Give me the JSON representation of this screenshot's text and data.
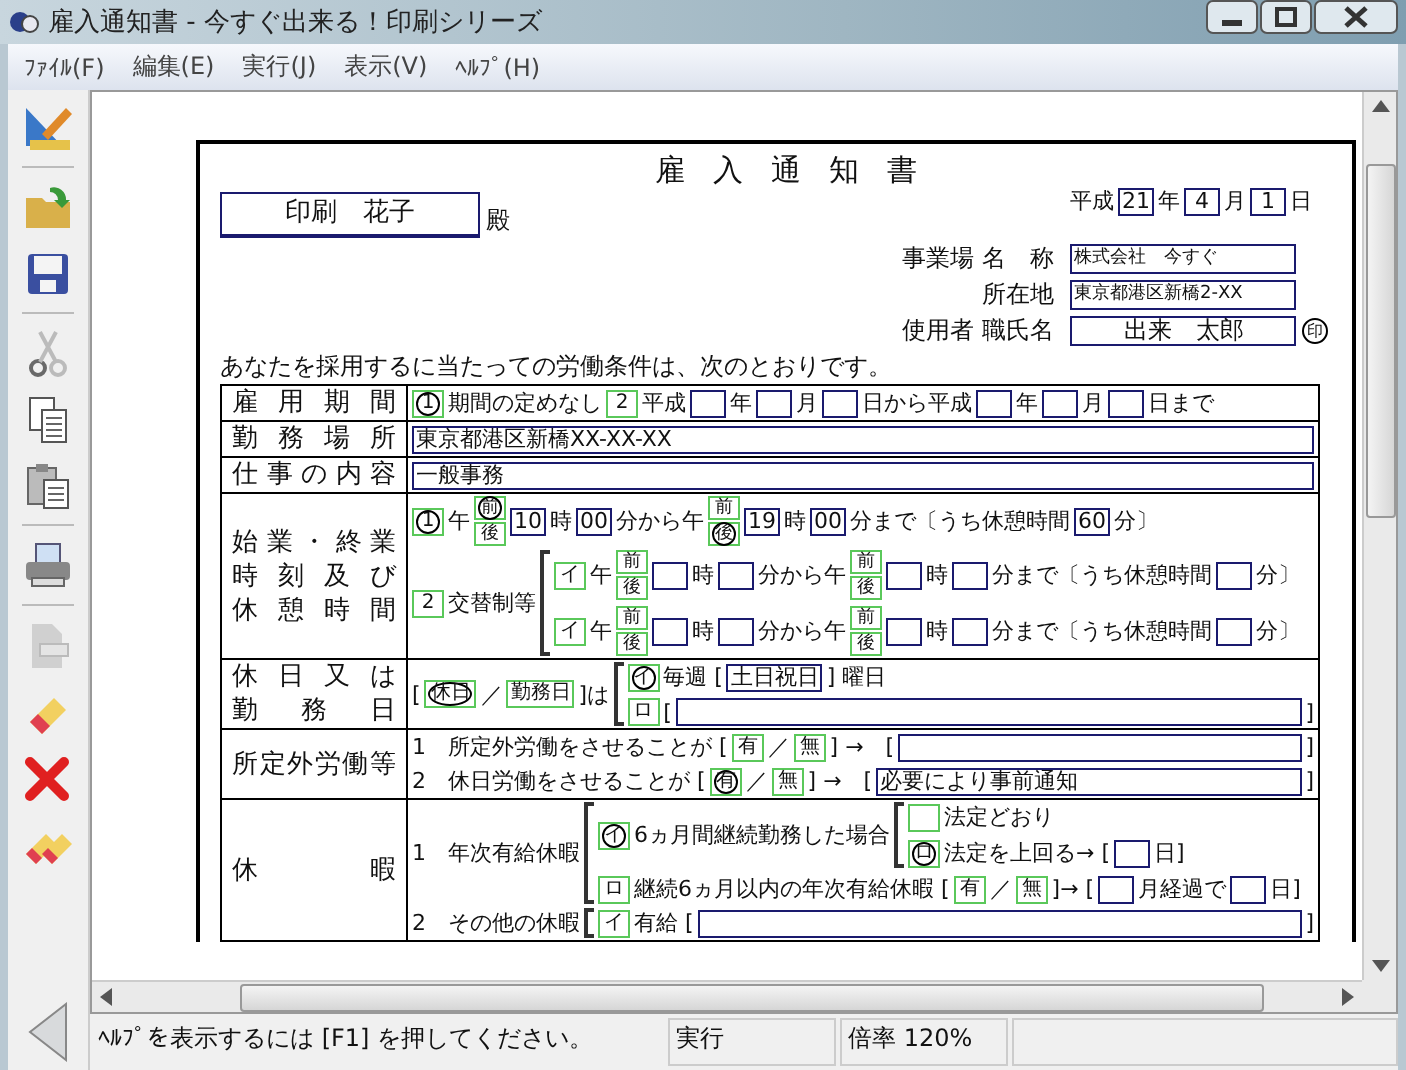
{
  "window": {
    "title": "雇入通知書 - 今すぐ出来る！印刷シリーズ"
  },
  "menu": [
    "ﾌｧｲﾙ(F)",
    "編集(E)",
    "実行(J)",
    "表示(V)",
    "ﾍﾙﾌﾟ(H)"
  ],
  "toolbar": [
    {
      "kind": "design",
      "separator_after": true,
      "disabled": false
    },
    {
      "kind": "open",
      "separator_after": false,
      "disabled": false
    },
    {
      "kind": "save",
      "separator_after": true,
      "disabled": false
    },
    {
      "kind": "cut",
      "separator_after": false,
      "disabled": true
    },
    {
      "kind": "copy",
      "separator_after": false,
      "disabled": false
    },
    {
      "kind": "paste",
      "separator_after": true,
      "disabled": false
    },
    {
      "kind": "print",
      "separator_after": true,
      "disabled": false
    },
    {
      "kind": "preview",
      "separator_after": false,
      "disabled": true
    },
    {
      "kind": "eraser",
      "separator_after": false,
      "disabled": false
    },
    {
      "kind": "delete",
      "separator_after": false,
      "disabled": false
    },
    {
      "kind": "clear",
      "separator_after": false,
      "disabled": false
    }
  ],
  "form": {
    "title": "雇入通知書",
    "date": [
      {
        "kind": "text",
        "text": "平成"
      },
      {
        "kind": "box",
        "value": "21"
      },
      {
        "kind": "text",
        "text": "年"
      },
      {
        "kind": "box",
        "value": "4"
      },
      {
        "kind": "text",
        "text": "月"
      },
      {
        "kind": "box",
        "value": "1"
      },
      {
        "kind": "text",
        "text": "日"
      }
    ],
    "recipient": {
      "name": "印刷　花子",
      "suffix": "殿"
    },
    "employer": [
      {
        "group": "事業場",
        "label": "名　称",
        "value": "株式会社　今すぐ"
      },
      {
        "label": "所在地",
        "value": "東京都港区新橋2-XX"
      },
      {
        "group": "使用者",
        "label": "職氏名",
        "value": "出来　太郎",
        "seal": "印"
      }
    ],
    "intro": "あなたを採用するに当たっての労働条件は、次のとおりです。",
    "rows": [
      {
        "label": [
          "雇用期間"
        ],
        "lines": [
          [
            {
              "kind": "opt",
              "label": "1",
              "selected": true
            },
            {
              "kind": "text",
              "text": "期間の定めなし"
            },
            {
              "kind": "opt",
              "label": "2",
              "selected": false
            },
            {
              "kind": "text",
              "text": "平成"
            },
            {
              "kind": "box"
            },
            {
              "kind": "text",
              "text": "年"
            },
            {
              "kind": "box"
            },
            {
              "kind": "text",
              "text": "月"
            },
            {
              "kind": "box"
            },
            {
              "kind": "text",
              "text": "日から平成"
            },
            {
              "kind": "box"
            },
            {
              "kind": "text",
              "text": "年"
            },
            {
              "kind": "box"
            },
            {
              "kind": "text",
              "text": "月"
            },
            {
              "kind": "box"
            },
            {
              "kind": "text",
              "text": "日まで"
            }
          ]
        ]
      },
      {
        "label": [
          "勤務場所"
        ],
        "lines": [
          [
            {
              "kind": "box",
              "value": "東京都港区新橋XX-XX-XX",
              "wide": true
            }
          ]
        ]
      },
      {
        "label": [
          "仕事の内容"
        ],
        "lines": [
          [
            {
              "kind": "box",
              "value": "一般事務",
              "wide": true
            }
          ]
        ]
      },
      {
        "label": [
          "始業・終業",
          "時刻及び",
          "休憩時間"
        ],
        "lines": [
          [
            {
              "kind": "opt",
              "label": "1",
              "selected": true
            },
            {
              "kind": "text",
              "text": "午"
            },
            {
              "kind": "ampm",
              "options": [
                {
                  "label": "前",
                  "selected": true
                },
                {
                  "label": "後",
                  "selected": false
                }
              ]
            },
            {
              "kind": "box",
              "value": "10"
            },
            {
              "kind": "text",
              "text": "時"
            },
            {
              "kind": "box",
              "value": "00"
            },
            {
              "kind": "text",
              "text": "分から午"
            },
            {
              "kind": "ampm",
              "options": [
                {
                  "label": "前",
                  "selected": false
                },
                {
                  "label": "後",
                  "selected": true
                }
              ]
            },
            {
              "kind": "box",
              "value": "19"
            },
            {
              "kind": "text",
              "text": "時"
            },
            {
              "kind": "box",
              "value": "00"
            },
            {
              "kind": "text",
              "text": "分まで〔うち休憩時間"
            },
            {
              "kind": "box",
              "value": "60"
            },
            {
              "kind": "text",
              "text": "分〕"
            }
          ],
          [
            {
              "kind": "opt",
              "label": "2",
              "selected": false
            },
            {
              "kind": "text",
              "text": "交替制等"
            },
            {
              "kind": "stack",
              "lines": [
                [
                  {
                    "kind": "opt",
                    "label": "イ",
                    "selected": false
                  },
                  {
                    "kind": "text",
                    "text": "午"
                  },
                  {
                    "kind": "ampm",
                    "options": [
                      {
                        "label": "前",
                        "selected": false
                      },
                      {
                        "label": "後",
                        "selected": false
                      }
                    ]
                  },
                  {
                    "kind": "box"
                  },
                  {
                    "kind": "text",
                    "text": "時"
                  },
                  {
                    "kind": "box"
                  },
                  {
                    "kind": "text",
                    "text": "分から午"
                  },
                  {
                    "kind": "ampm",
                    "options": [
                      {
                        "label": "前",
                        "selected": false
                      },
                      {
                        "label": "後",
                        "selected": false
                      }
                    ]
                  },
                  {
                    "kind": "box"
                  },
                  {
                    "kind": "text",
                    "text": "時"
                  },
                  {
                    "kind": "box"
                  },
                  {
                    "kind": "text",
                    "text": "分まで〔うち休憩時間"
                  },
                  {
                    "kind": "box"
                  },
                  {
                    "kind": "text",
                    "text": "分〕"
                  }
                ],
                [
                  {
                    "kind": "opt",
                    "label": "イ",
                    "selected": false
                  },
                  {
                    "kind": "text",
                    "text": "午"
                  },
                  {
                    "kind": "ampm",
                    "options": [
                      {
                        "label": "前",
                        "selected": false
                      },
                      {
                        "label": "後",
                        "selected": false
                      }
                    ]
                  },
                  {
                    "kind": "box"
                  },
                  {
                    "kind": "text",
                    "text": "時"
                  },
                  {
                    "kind": "box"
                  },
                  {
                    "kind": "text",
                    "text": "分から午"
                  },
                  {
                    "kind": "ampm",
                    "options": [
                      {
                        "label": "前",
                        "selected": false
                      },
                      {
                        "label": "後",
                        "selected": false
                      }
                    ]
                  },
                  {
                    "kind": "box"
                  },
                  {
                    "kind": "text",
                    "text": "時"
                  },
                  {
                    "kind": "box"
                  },
                  {
                    "kind": "text",
                    "text": "分まで〔うち休憩時間"
                  },
                  {
                    "kind": "box"
                  },
                  {
                    "kind": "text",
                    "text": "分〕"
                  }
                ]
              ]
            }
          ]
        ]
      },
      {
        "label": [
          "休日又は",
          "勤務日"
        ],
        "lines": [
          [
            {
              "kind": "text",
              "text": "["
            },
            {
              "kind": "opt",
              "label": "休日",
              "selected": true
            },
            {
              "kind": "text",
              "text": "／"
            },
            {
              "kind": "opt",
              "label": "勤務日",
              "selected": false
            },
            {
              "kind": "text",
              "text": "]は"
            },
            {
              "kind": "stack",
              "lines": [
                [
                  {
                    "kind": "opt",
                    "label": "イ",
                    "selected": true
                  },
                  {
                    "kind": "text",
                    "text": "毎週 ["
                  },
                  {
                    "kind": "box",
                    "value": "土日祝日"
                  },
                  {
                    "kind": "text",
                    "text": "] 曜日"
                  }
                ],
                [
                  {
                    "kind": "opt",
                    "label": "ロ",
                    "selected": false
                  },
                  {
                    "kind": "text",
                    "text": "["
                  },
                  {
                    "kind": "box",
                    "wide": true
                  },
                  {
                    "kind": "text",
                    "text": "]"
                  }
                ]
              ]
            }
          ]
        ]
      },
      {
        "label": [
          "所定外労働等"
        ],
        "lines": [
          [
            {
              "kind": "text",
              "text": "1　所定外労働をさせることが ["
            },
            {
              "kind": "opt",
              "label": "有",
              "selected": false
            },
            {
              "kind": "text",
              "text": "／"
            },
            {
              "kind": "opt",
              "label": "無",
              "selected": false
            },
            {
              "kind": "text",
              "text": "] →　["
            },
            {
              "kind": "box",
              "wide": true
            },
            {
              "kind": "text",
              "text": "]"
            }
          ],
          [
            {
              "kind": "text",
              "text": "2　休日労働をさせることが ["
            },
            {
              "kind": "opt",
              "label": "有",
              "selected": true
            },
            {
              "kind": "text",
              "text": "／"
            },
            {
              "kind": "opt",
              "label": "無",
              "selected": false
            },
            {
              "kind": "text",
              "text": "] →　["
            },
            {
              "kind": "box",
              "value": "必要により事前通知",
              "wide": true
            },
            {
              "kind": "text",
              "text": "]"
            }
          ]
        ]
      },
      {
        "label": [
          "休暇"
        ],
        "lines": [
          [
            {
              "kind": "text",
              "text": "1　年次有給休暇"
            },
            {
              "kind": "stack",
              "lines": [
                [
                  {
                    "kind": "opt",
                    "label": "イ",
                    "selected": true
                  },
                  {
                    "kind": "text",
                    "text": "6ヵ月間継続勤務した場合"
                  },
                  {
                    "kind": "stack",
                    "lines": [
                      [
                        {
                          "kind": "opt",
                          "selected": false
                        },
                        {
                          "kind": "text",
                          "text": "法定どおり"
                        }
                      ],
                      [
                        {
                          "kind": "opt",
                          "label": "ロ",
                          "selected": true
                        },
                        {
                          "kind": "text",
                          "text": "法定を上回る→ ["
                        },
                        {
                          "kind": "box"
                        },
                        {
                          "kind": "text",
                          "text": "日]"
                        }
                      ]
                    ]
                  }
                ],
                [
                  {
                    "kind": "opt",
                    "label": "ロ",
                    "selected": false
                  },
                  {
                    "kind": "text",
                    "text": "継続6ヵ月以内の年次有給休暇 ["
                  },
                  {
                    "kind": "opt",
                    "label": "有",
                    "selected": false
                  },
                  {
                    "kind": "text",
                    "text": "／"
                  },
                  {
                    "kind": "opt",
                    "label": "無",
                    "selected": false
                  },
                  {
                    "kind": "text",
                    "text": "]→ ["
                  },
                  {
                    "kind": "box"
                  },
                  {
                    "kind": "text",
                    "text": "月経過で"
                  },
                  {
                    "kind": "box"
                  },
                  {
                    "kind": "text",
                    "text": "日]"
                  }
                ]
              ]
            }
          ],
          [
            {
              "kind": "text",
              "text": "2　その他の休暇"
            },
            {
              "kind": "stack",
              "lines": [
                [
                  {
                    "kind": "opt",
                    "label": "イ",
                    "selected": false
                  },
                  {
                    "kind": "text",
                    "text": "有給 ["
                  },
                  {
                    "kind": "box",
                    "wide": true
                  },
                  {
                    "kind": "text",
                    "text": "]"
                  }
                ]
              ]
            }
          ]
        ]
      }
    ]
  },
  "status_bar": {
    "message": "ﾍﾙﾌﾟを表示するには [F1] を押してください。",
    "mode": "実行",
    "zoom": "倍率 120%"
  }
}
